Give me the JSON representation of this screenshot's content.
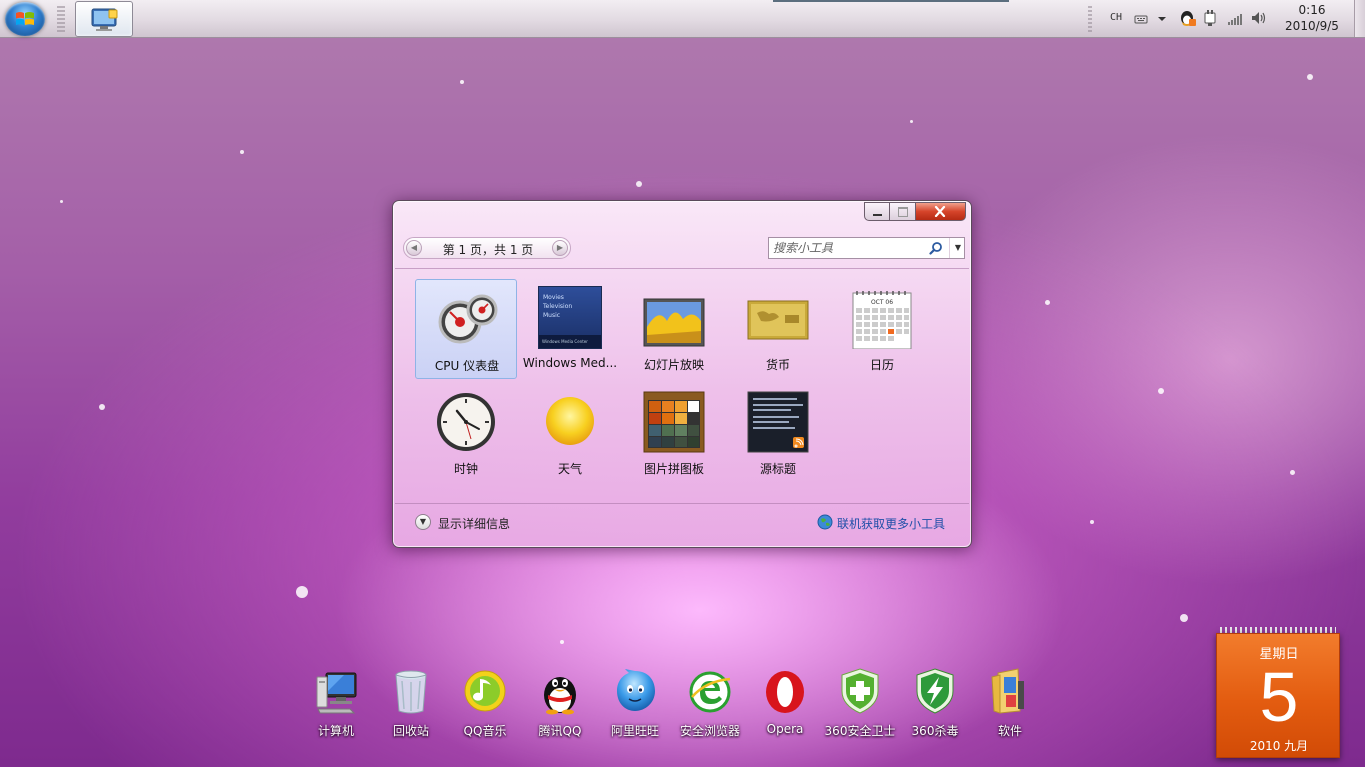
{
  "taskbar": {
    "lang": "CH",
    "clock_time": "0:16",
    "clock_date": "2010/9/5"
  },
  "gadget_window": {
    "pager_text": "第 1 页，共 1 页",
    "search_placeholder": "搜索小工具",
    "gadgets": [
      {
        "label": "CPU 仪表盘",
        "icon": "cpu-meter-icon",
        "selected": true
      },
      {
        "label": "Windows Med...",
        "icon": "windows-media-center-icon",
        "selected": false
      },
      {
        "label": "幻灯片放映",
        "icon": "slideshow-icon",
        "selected": false
      },
      {
        "label": "货币",
        "icon": "currency-icon",
        "selected": false
      },
      {
        "label": "日历",
        "icon": "calendar-icon",
        "selected": false
      },
      {
        "label": "时钟",
        "icon": "clock-icon",
        "selected": false
      },
      {
        "label": "天气",
        "icon": "weather-icon",
        "selected": false
      },
      {
        "label": "图片拼图板",
        "icon": "picture-puzzle-icon",
        "selected": false
      },
      {
        "label": "源标题",
        "icon": "feed-headlines-icon",
        "selected": false
      }
    ],
    "wmc_lines": [
      "Movies",
      "Television",
      "Music"
    ],
    "wmc_footer": "Windows Media Center",
    "cal_month": "OCT 06",
    "show_details": "显示详细信息",
    "get_more_online": "联机获取更多小工具"
  },
  "dock": [
    {
      "label": "计算机",
      "icon": "computer-icon"
    },
    {
      "label": "回收站",
      "icon": "recycle-bin-icon"
    },
    {
      "label": "QQ音乐",
      "icon": "qq-music-icon"
    },
    {
      "label": "腾讯QQ",
      "icon": "qq-penguin-icon"
    },
    {
      "label": "阿里旺旺",
      "icon": "aliwangwang-icon"
    },
    {
      "label": "安全浏览器",
      "icon": "safe-browser-icon"
    },
    {
      "label": "Opera",
      "icon": "opera-icon"
    },
    {
      "label": "360安全卫士",
      "icon": "360-safeguard-icon"
    },
    {
      "label": "360杀毒",
      "icon": "360-antivirus-icon"
    },
    {
      "label": "软件",
      "icon": "software-folder-icon"
    }
  ],
  "calendar_widget": {
    "weekday": "星期日",
    "day": "5",
    "year_month": "2010 九月"
  },
  "colors": {
    "calendar_orange": "#e35c10",
    "link_blue": "#1f4fa8",
    "close_red": "#d6442a"
  }
}
